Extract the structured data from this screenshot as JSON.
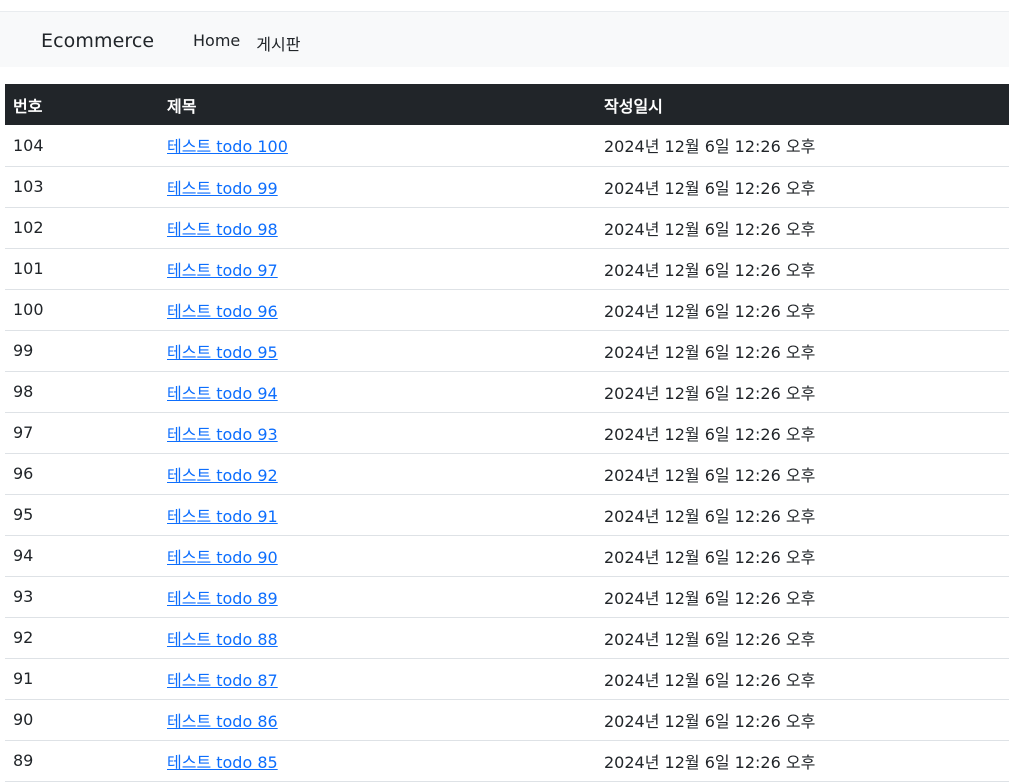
{
  "navbar": {
    "brand": "Ecommerce",
    "links": [
      {
        "label": "Home"
      },
      {
        "label": "게시판"
      }
    ]
  },
  "table": {
    "headers": {
      "number": "번호",
      "title": "제목",
      "created": "작성일시"
    },
    "rows": [
      {
        "number": "104",
        "title": "테스트 todo 100",
        "created": "2024년 12월 6일 12:26 오후"
      },
      {
        "number": "103",
        "title": "테스트 todo 99",
        "created": "2024년 12월 6일 12:26 오후"
      },
      {
        "number": "102",
        "title": "테스트 todo 98",
        "created": "2024년 12월 6일 12:26 오후"
      },
      {
        "number": "101",
        "title": "테스트 todo 97",
        "created": "2024년 12월 6일 12:26 오후"
      },
      {
        "number": "100",
        "title": "테스트 todo 96",
        "created": "2024년 12월 6일 12:26 오후"
      },
      {
        "number": "99",
        "title": "테스트 todo 95",
        "created": "2024년 12월 6일 12:26 오후"
      },
      {
        "number": "98",
        "title": "테스트 todo 94",
        "created": "2024년 12월 6일 12:26 오후"
      },
      {
        "number": "97",
        "title": "테스트 todo 93",
        "created": "2024년 12월 6일 12:26 오후"
      },
      {
        "number": "96",
        "title": "테스트 todo 92",
        "created": "2024년 12월 6일 12:26 오후"
      },
      {
        "number": "95",
        "title": "테스트 todo 91",
        "created": "2024년 12월 6일 12:26 오후"
      },
      {
        "number": "94",
        "title": "테스트 todo 90",
        "created": "2024년 12월 6일 12:26 오후"
      },
      {
        "number": "93",
        "title": "테스트 todo 89",
        "created": "2024년 12월 6일 12:26 오후"
      },
      {
        "number": "92",
        "title": "테스트 todo 88",
        "created": "2024년 12월 6일 12:26 오후"
      },
      {
        "number": "91",
        "title": "테스트 todo 87",
        "created": "2024년 12월 6일 12:26 오후"
      },
      {
        "number": "90",
        "title": "테스트 todo 86",
        "created": "2024년 12월 6일 12:26 오후"
      },
      {
        "number": "89",
        "title": "테스트 todo 85",
        "created": "2024년 12월 6일 12:26 오후"
      }
    ]
  },
  "colors": {
    "header_bg": "#212529",
    "link": "#0d6efd",
    "navbar_bg": "#f8f9fa"
  }
}
